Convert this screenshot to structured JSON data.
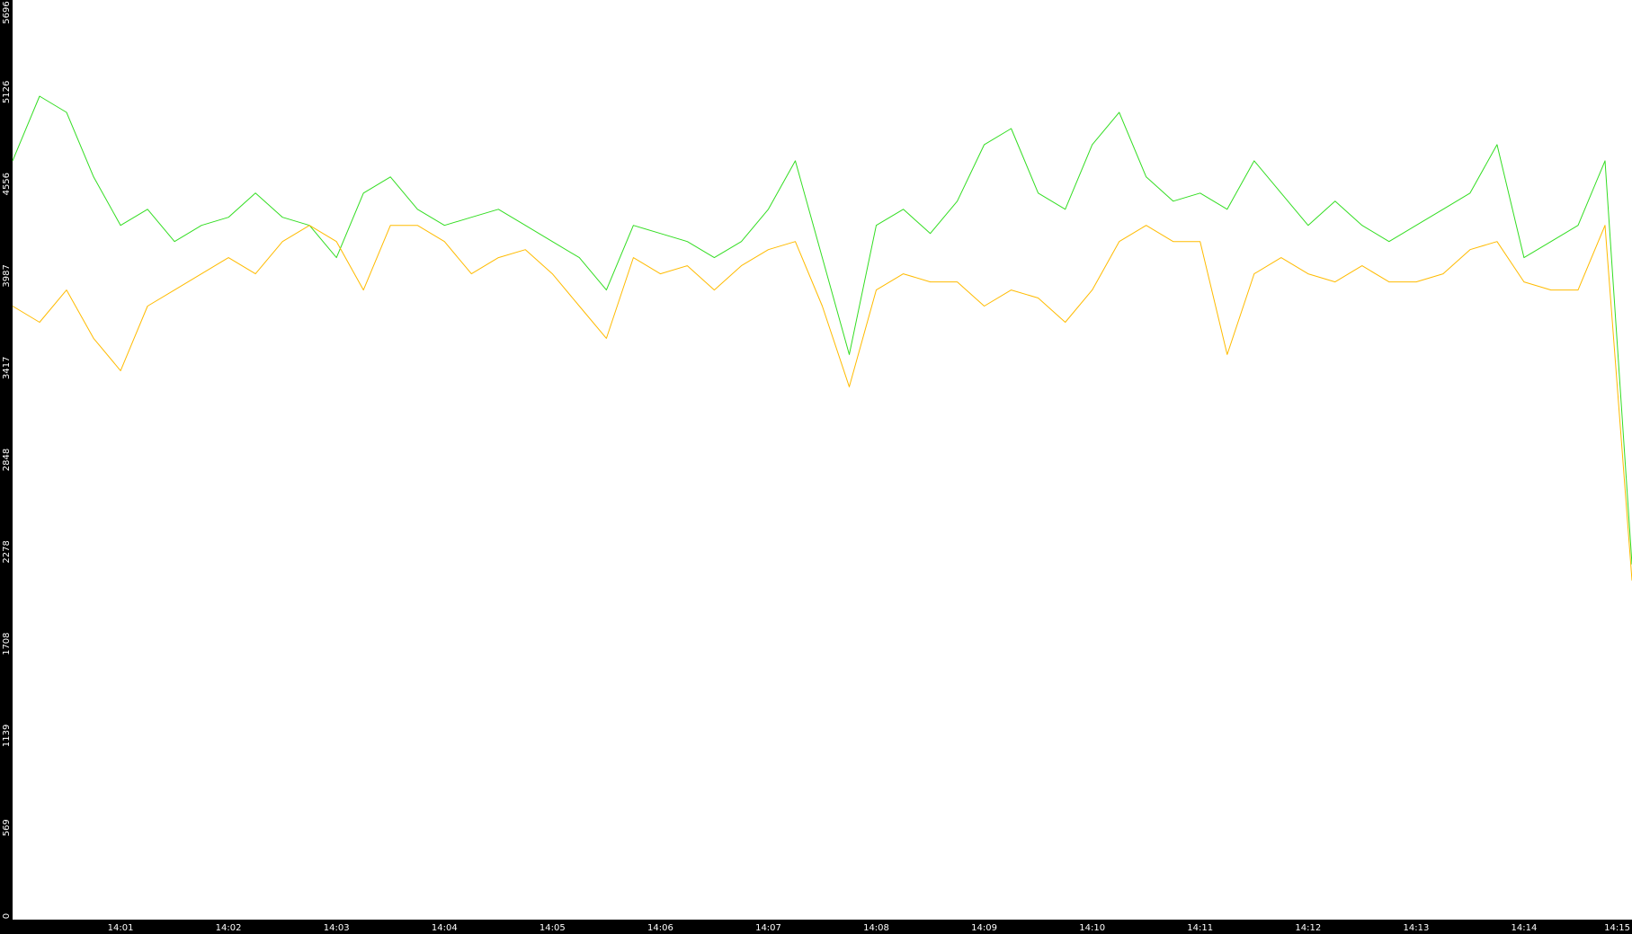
{
  "chart_data": {
    "type": "line",
    "title": "",
    "xlabel": "",
    "ylabel": "",
    "colors": {
      "background": "#ffffff",
      "axis": "#000000",
      "tick_text": "#ffffff"
    },
    "grid": false,
    "legend": "none",
    "x_ticks": [
      "14:01",
      "14:02",
      "14:03",
      "14:04",
      "14:05",
      "14:06",
      "14:07",
      "14:08",
      "14:09",
      "14:10",
      "14:11",
      "14:12",
      "14:13",
      "14:14",
      "14:15"
    ],
    "y_ticks": [
      "0",
      "569",
      "1139",
      "1708",
      "2278",
      "2848",
      "3417",
      "3987",
      "4556",
      "5126",
      "5696"
    ],
    "x_range": [
      "14:00",
      "14:15"
    ],
    "ylim": [
      0,
      5696
    ],
    "series": [
      {
        "color": "#33dd22",
        "x": [
          "14:00:00",
          "14:00:15",
          "14:00:30",
          "14:00:45",
          "14:01:00",
          "14:01:15",
          "14:01:30",
          "14:01:45",
          "14:02:00",
          "14:02:15",
          "14:02:30",
          "14:02:45",
          "14:03:00",
          "14:03:15",
          "14:03:30",
          "14:03:45",
          "14:04:00",
          "14:04:15",
          "14:04:30",
          "14:04:45",
          "14:05:00",
          "14:05:15",
          "14:05:30",
          "14:05:45",
          "14:06:00",
          "14:06:15",
          "14:06:30",
          "14:06:45",
          "14:07:00",
          "14:07:15",
          "14:07:30",
          "14:07:45",
          "14:08:00",
          "14:08:15",
          "14:08:30",
          "14:08:45",
          "14:09:00",
          "14:09:15",
          "14:09:30",
          "14:09:45",
          "14:10:00",
          "14:10:15",
          "14:10:30",
          "14:10:45",
          "14:11:00",
          "14:11:15",
          "14:11:30",
          "14:11:45",
          "14:12:00",
          "14:12:15",
          "14:12:30",
          "14:12:45",
          "14:13:00",
          "14:13:15",
          "14:13:30",
          "14:13:45",
          "14:14:00",
          "14:14:15",
          "14:14:30",
          "14:14:45",
          "14:15:00"
        ],
        "y": [
          4700,
          5100,
          5000,
          4600,
          4300,
          4400,
          4200,
          4300,
          4350,
          4500,
          4350,
          4300,
          4100,
          4500,
          4600,
          4400,
          4300,
          4350,
          4400,
          4300,
          4200,
          4100,
          3900,
          4300,
          4250,
          4200,
          4100,
          4200,
          4400,
          4700,
          4100,
          3500,
          4300,
          4400,
          4250,
          4450,
          4800,
          4900,
          4500,
          4400,
          4800,
          5000,
          4600,
          4450,
          4500,
          4400,
          4700,
          4500,
          4300,
          4450,
          4300,
          4200,
          4300,
          4400,
          4500,
          4800,
          4100,
          4200,
          4300,
          4700,
          2200
        ]
      },
      {
        "color": "#ffbb00",
        "x": [
          "14:00:00",
          "14:00:15",
          "14:00:30",
          "14:00:45",
          "14:01:00",
          "14:01:15",
          "14:01:30",
          "14:01:45",
          "14:02:00",
          "14:02:15",
          "14:02:30",
          "14:02:45",
          "14:03:00",
          "14:03:15",
          "14:03:30",
          "14:03:45",
          "14:04:00",
          "14:04:15",
          "14:04:30",
          "14:04:45",
          "14:05:00",
          "14:05:15",
          "14:05:30",
          "14:05:45",
          "14:06:00",
          "14:06:15",
          "14:06:30",
          "14:06:45",
          "14:07:00",
          "14:07:15",
          "14:07:30",
          "14:07:45",
          "14:08:00",
          "14:08:15",
          "14:08:30",
          "14:08:45",
          "14:09:00",
          "14:09:15",
          "14:09:30",
          "14:09:45",
          "14:10:00",
          "14:10:15",
          "14:10:30",
          "14:10:45",
          "14:11:00",
          "14:11:15",
          "14:11:30",
          "14:11:45",
          "14:12:00",
          "14:12:15",
          "14:12:30",
          "14:12:45",
          "14:13:00",
          "14:13:15",
          "14:13:30",
          "14:13:45",
          "14:14:00",
          "14:14:15",
          "14:14:30",
          "14:14:45",
          "14:15:00"
        ],
        "y": [
          3800,
          3700,
          3900,
          3600,
          3400,
          3800,
          3900,
          4000,
          4100,
          4000,
          4200,
          4300,
          4200,
          3900,
          4300,
          4300,
          4200,
          4000,
          4100,
          4150,
          4000,
          3800,
          3600,
          4100,
          4000,
          4050,
          3900,
          4050,
          4150,
          4200,
          3800,
          3300,
          3900,
          4000,
          3950,
          3950,
          3800,
          3900,
          3850,
          3700,
          3900,
          4200,
          4300,
          4200,
          4200,
          3500,
          4000,
          4100,
          4000,
          3950,
          4050,
          3950,
          3950,
          4000,
          4150,
          4200,
          3950,
          3900,
          3900,
          4300,
          2100
        ]
      }
    ]
  }
}
